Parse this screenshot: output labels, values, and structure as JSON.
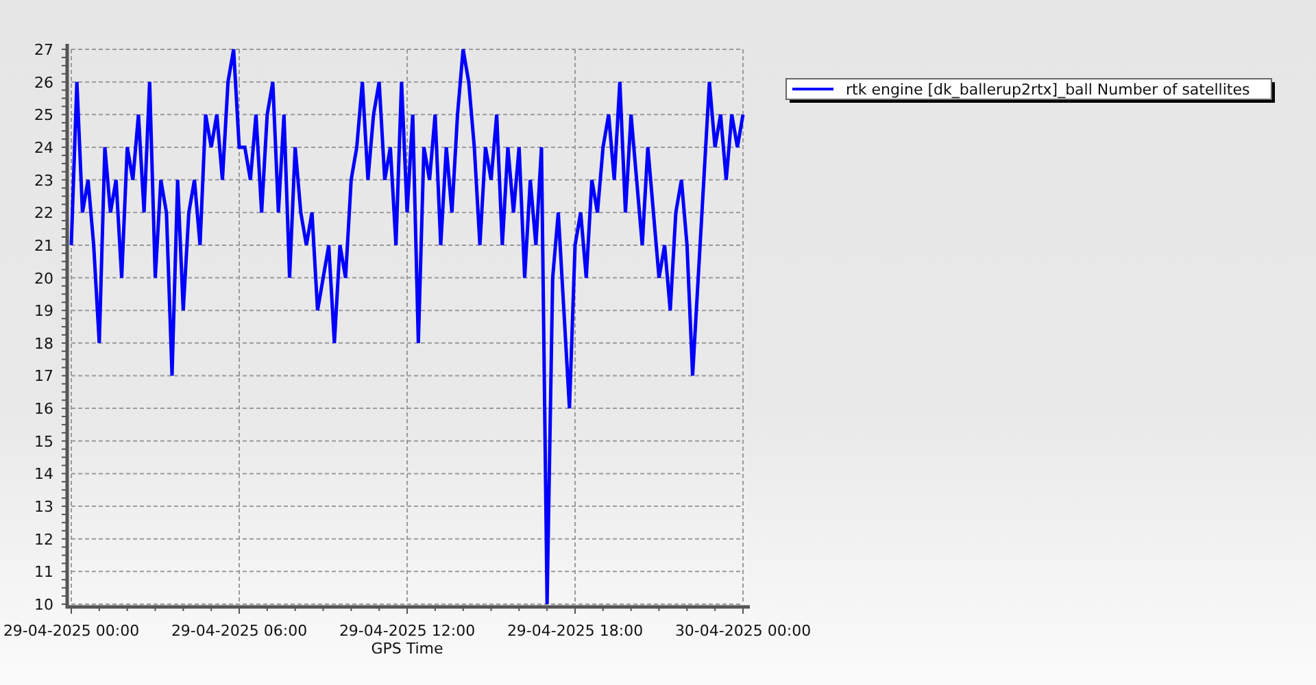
{
  "chart": {
    "chart_data": {
      "type": "line",
      "grid": true,
      "xlabel": "GPS Time",
      "ylim": [
        10,
        27
      ],
      "yticks": [
        10,
        11,
        12,
        13,
        14,
        15,
        16,
        17,
        18,
        19,
        20,
        21,
        22,
        23,
        24,
        25,
        26,
        27
      ],
      "categories": [
        "29-04-2025 00:00",
        null,
        null,
        null,
        null,
        null,
        null,
        null,
        null,
        null,
        null,
        null,
        null,
        null,
        null,
        null,
        null,
        null,
        null,
        null,
        null,
        null,
        null,
        null,
        null,
        null,
        null,
        null,
        null,
        null,
        "29-04-2025 06:00",
        null,
        null,
        null,
        null,
        null,
        null,
        null,
        null,
        null,
        null,
        null,
        null,
        null,
        null,
        null,
        null,
        null,
        null,
        null,
        null,
        null,
        null,
        null,
        null,
        null,
        null,
        null,
        null,
        null,
        "29-04-2025 12:00",
        null,
        null,
        null,
        null,
        null,
        null,
        null,
        null,
        null,
        null,
        null,
        null,
        null,
        null,
        null,
        null,
        null,
        null,
        null,
        null,
        null,
        null,
        null,
        null,
        null,
        null,
        null,
        null,
        null,
        "29-04-2025 18:00",
        null,
        null,
        null,
        null,
        null,
        null,
        null,
        null,
        null,
        null,
        null,
        null,
        null,
        null,
        null,
        null,
        null,
        null,
        null,
        null,
        null,
        null,
        null,
        null,
        null,
        null,
        null,
        null,
        null,
        "30-04-2025 00:00"
      ],
      "series": [
        {
          "name": "rtk engine [dk_ballerup2rtx]_ball Number of satellites",
          "color": "#0000ff",
          "values": [
            21,
            26,
            22,
            23,
            21,
            18,
            24,
            22,
            23,
            20,
            24,
            23,
            25,
            22,
            26,
            20,
            23,
            22,
            17,
            23,
            19,
            22,
            23,
            21,
            25,
            24,
            25,
            23,
            26,
            27,
            24,
            24,
            23,
            25,
            22,
            25,
            26,
            22,
            25,
            20,
            24,
            22,
            21,
            22,
            19,
            20,
            21,
            18,
            21,
            20,
            23,
            24,
            26,
            23,
            25,
            26,
            23,
            24,
            21,
            26,
            22,
            25,
            18,
            24,
            23,
            25,
            21,
            24,
            22,
            25,
            27,
            26,
            24,
            21,
            24,
            23,
            25,
            21,
            24,
            22,
            24,
            20,
            23,
            21,
            24,
            10,
            20,
            22,
            19,
            16,
            21,
            22,
            20,
            23,
            22,
            24,
            25,
            23,
            26,
            22,
            25,
            23,
            21,
            24,
            22,
            20,
            21,
            19,
            22,
            23,
            21,
            17,
            20,
            23,
            26,
            24,
            25,
            23,
            25,
            24,
            25
          ]
        }
      ]
    }
  }
}
